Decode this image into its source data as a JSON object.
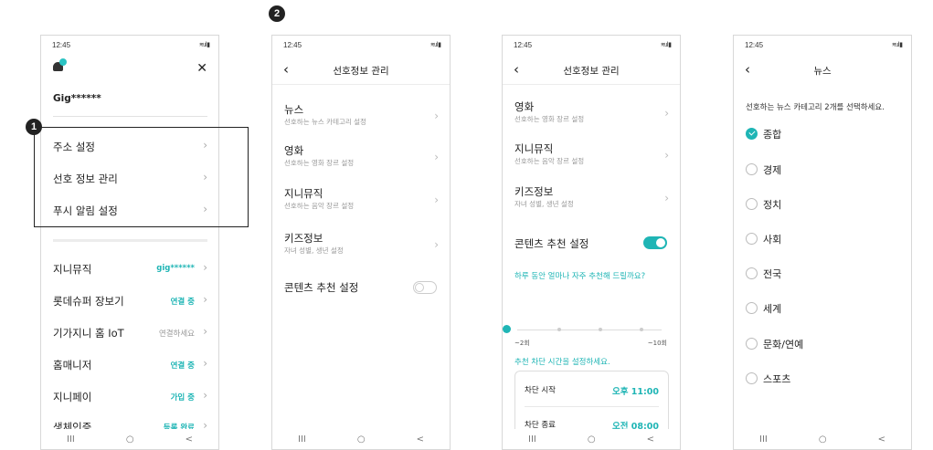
{
  "status_time": "12:45",
  "status_icons": "≋.ıl ▮",
  "nav": {
    "recents": "III",
    "home": "○",
    "back": "<"
  },
  "callouts": {
    "one": "1",
    "two": "2"
  },
  "phone1": {
    "username": "Gig******",
    "close_label": "✕",
    "menu": [
      {
        "label": "주소 설정"
      },
      {
        "label": "선호 정보 관리"
      },
      {
        "label": "푸시 알림 설정"
      }
    ],
    "services": [
      {
        "label": "지니뮤직",
        "status": "gig******"
      },
      {
        "label": "롯데슈퍼 장보기",
        "status": "연결 중"
      },
      {
        "label": "기가지니 홈 IoT",
        "status": "연결하세요"
      },
      {
        "label": "홈매니저",
        "status": "연결 중"
      },
      {
        "label": "지니페이",
        "status": "가입 중"
      },
      {
        "label": "생체인증",
        "status": "등록 완료"
      }
    ]
  },
  "phone2": {
    "title": "선호정보 관리",
    "items": [
      {
        "title": "뉴스",
        "sub": "선호하는 뉴스 카테고리 설정"
      },
      {
        "title": "영화",
        "sub": "선호하는 영화 장르 설정"
      },
      {
        "title": "지니뮤직",
        "sub": "선호하는 음악 장르 설정"
      },
      {
        "title": "키즈정보",
        "sub": "자녀 성별, 생년 설정"
      }
    ],
    "recommend_label": "콘텐츠 추천 설정"
  },
  "phone3": {
    "title": "선호정보 관리",
    "items": [
      {
        "title": "영화",
        "sub": "선호하는 영화 장르 설정"
      },
      {
        "title": "지니뮤직",
        "sub": "선호하는 음악 장르 설정"
      },
      {
        "title": "키즈정보",
        "sub": "자녀 성별, 생년 설정"
      }
    ],
    "recommend_label": "콘텐츠 추천 설정",
    "frequency_question": "하루 동안 얼마나 자주 추천해 드릴까요?",
    "slider_min": "~2회",
    "slider_max": "~10회",
    "slider_level": 0,
    "block_prompt": "추천 차단 시간을 설정하세요.",
    "block_start_label": "차단 시작",
    "block_start_value": "오후 11:00",
    "block_end_label": "차단 종료",
    "block_end_value": "오전 08:00"
  },
  "phone4": {
    "title": "뉴스",
    "guide": "선호하는 뉴스 카테고리 2개를 선택하세요.",
    "options": [
      {
        "label": "종합",
        "selected": true
      },
      {
        "label": "경제",
        "selected": false
      },
      {
        "label": "정치",
        "selected": false
      },
      {
        "label": "사회",
        "selected": false
      },
      {
        "label": "전국",
        "selected": false
      },
      {
        "label": "세계",
        "selected": false
      },
      {
        "label": "문화/연예",
        "selected": false
      },
      {
        "label": "스포츠",
        "selected": false
      }
    ]
  }
}
